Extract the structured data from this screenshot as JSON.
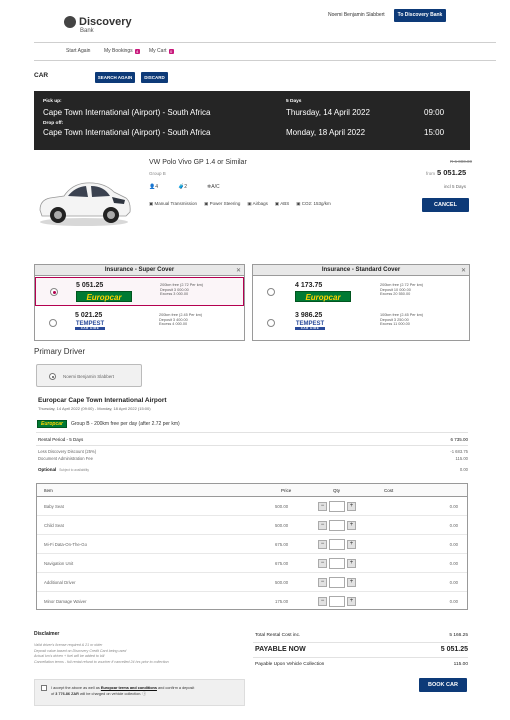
{
  "header": {
    "brand_name": "Discovery",
    "brand_sub": "Bank",
    "user_name": "Noemi Benjamin Slabbert",
    "to_bank_label": "To Discovery Bank"
  },
  "nav": {
    "start_again": "Start Again",
    "my_bookings": "My Bookings",
    "my_bookings_count": "4",
    "my_cart": "My Cart",
    "my_cart_count": "0"
  },
  "section": {
    "title": "CAR",
    "search_again": "SEARCH AGAIN",
    "discard": "DISCARD"
  },
  "summary": {
    "pickup_label": "Pick up:",
    "pickup_location": "Cape Town International (Airport) - South Africa",
    "dropoff_label": "Drop off:",
    "dropoff_location": "Cape Town International (Airport) - South Africa",
    "days": "5 Days",
    "pickup_date": "Thursday, 14 April 2022",
    "dropoff_date": "Monday, 18 April 2022",
    "pickup_time": "09:00",
    "dropoff_time": "15:00"
  },
  "car": {
    "name": "VW Polo Vivo GP 1.4 or Similar",
    "group": "Group B",
    "seats": "4",
    "bags": "2",
    "ac": "A/C",
    "transmission": "Manual Transmission",
    "steering": "Power Steering",
    "airbags": "Airbags",
    "abs": "ABS",
    "co2": "CO2: 153g/km",
    "old_price": "R 6 000.00",
    "from_label": "from",
    "price": "5 051.25",
    "per": "incl 5 Days",
    "cancel": "CANCEL"
  },
  "insurance": {
    "super": {
      "title": "Insurance - Super Cover",
      "options": [
        {
          "price": "5 051.25",
          "vendor": "Europcar",
          "km": "200km free (2.72 Per km)",
          "deposit": "Deposit 3 000.00",
          "excess": "Excess 3 000.00"
        },
        {
          "price": "5 021.25",
          "vendor": "TEMPEST",
          "km": "200km free (2.45 Per km)",
          "deposit": "Deposit 3 400.00",
          "excess": "Excess 4 000.00"
        }
      ]
    },
    "standard": {
      "title": "Insurance - Standard Cover",
      "options": [
        {
          "price": "4 173.75",
          "vendor": "Europcar",
          "km": "200km free (2.72 Per km)",
          "deposit": "Deposit 10 000.00",
          "excess": "Excess 20 550.00"
        },
        {
          "price": "3 986.25",
          "vendor": "TEMPEST",
          "km": "100km free (2.45 Per km)",
          "deposit": "Deposit 3 250.00",
          "excess": "Excess 11 000.00"
        }
      ]
    }
  },
  "primary_driver": {
    "title": "Primary Driver",
    "name": "Noemi Benjamin Slabbert"
  },
  "booking": {
    "branch": "Europcar Cape Town International Airport",
    "dates": "Thursday, 14 April 2022 (09:00) - Monday, 18 April 2022 (15:00)",
    "group_line": "Group B - 200km free per day (after 2.72 per km)",
    "rental_period_label": "Rental Period - 5 Days",
    "rental_period_value": "6 735.00",
    "discount_label": "Less Discovery Discount (25%)",
    "discount_value": "-1 683.75",
    "admin_fee_label": "Document Administration Fee",
    "admin_fee_value": "115.00",
    "optional_label": "Optional",
    "optional_note": "Subject to availability",
    "optional_value": "0.00"
  },
  "extras": {
    "headers": {
      "item": "Item",
      "price": "Price",
      "qty": "Qty",
      "cost": "Cost"
    },
    "rows": [
      {
        "item": "Baby Seat",
        "price": "500.00",
        "cost": "0.00"
      },
      {
        "item": "Child Seat",
        "price": "500.00",
        "cost": "0.00"
      },
      {
        "item": "Mi-Fi Data-On-The-Go",
        "price": "675.00",
        "cost": "0.00"
      },
      {
        "item": "Navigation Unit",
        "price": "675.00",
        "cost": "0.00"
      },
      {
        "item": "Additional Driver",
        "price": "500.00",
        "cost": "0.00"
      },
      {
        "item": "Minor Damage Waiver",
        "price": "175.00",
        "cost": "0.00"
      }
    ]
  },
  "disclaimer": {
    "title": "Disclaimer",
    "lines": [
      "Valid driver's license required & 21 or older",
      "Deposit value based on Discovery Credit Card being used",
      "Actual km's driven + fuel will be added to bill",
      "Cancellation terms - full rental refund to voucher if cancelled 24 hrs prior to collection"
    ]
  },
  "totals": {
    "total_label": "Total Rental Cost inc.",
    "total_value": "5 166.25",
    "payable_label": "PAYABLE NOW",
    "payable_value": "5 051.25",
    "collection_label": "Payable Upon Vehicle Collection",
    "collection_value": "115.00"
  },
  "terms": {
    "text_a": "I accept the above as well as",
    "link": "Europcar terms and conditions",
    "text_b": "and confirm a deposit",
    "text_c": "of",
    "deposit": "3 776.86 ZAR",
    "text_d": "will be charged on vehicle collection."
  },
  "book_car": "BOOK CAR"
}
